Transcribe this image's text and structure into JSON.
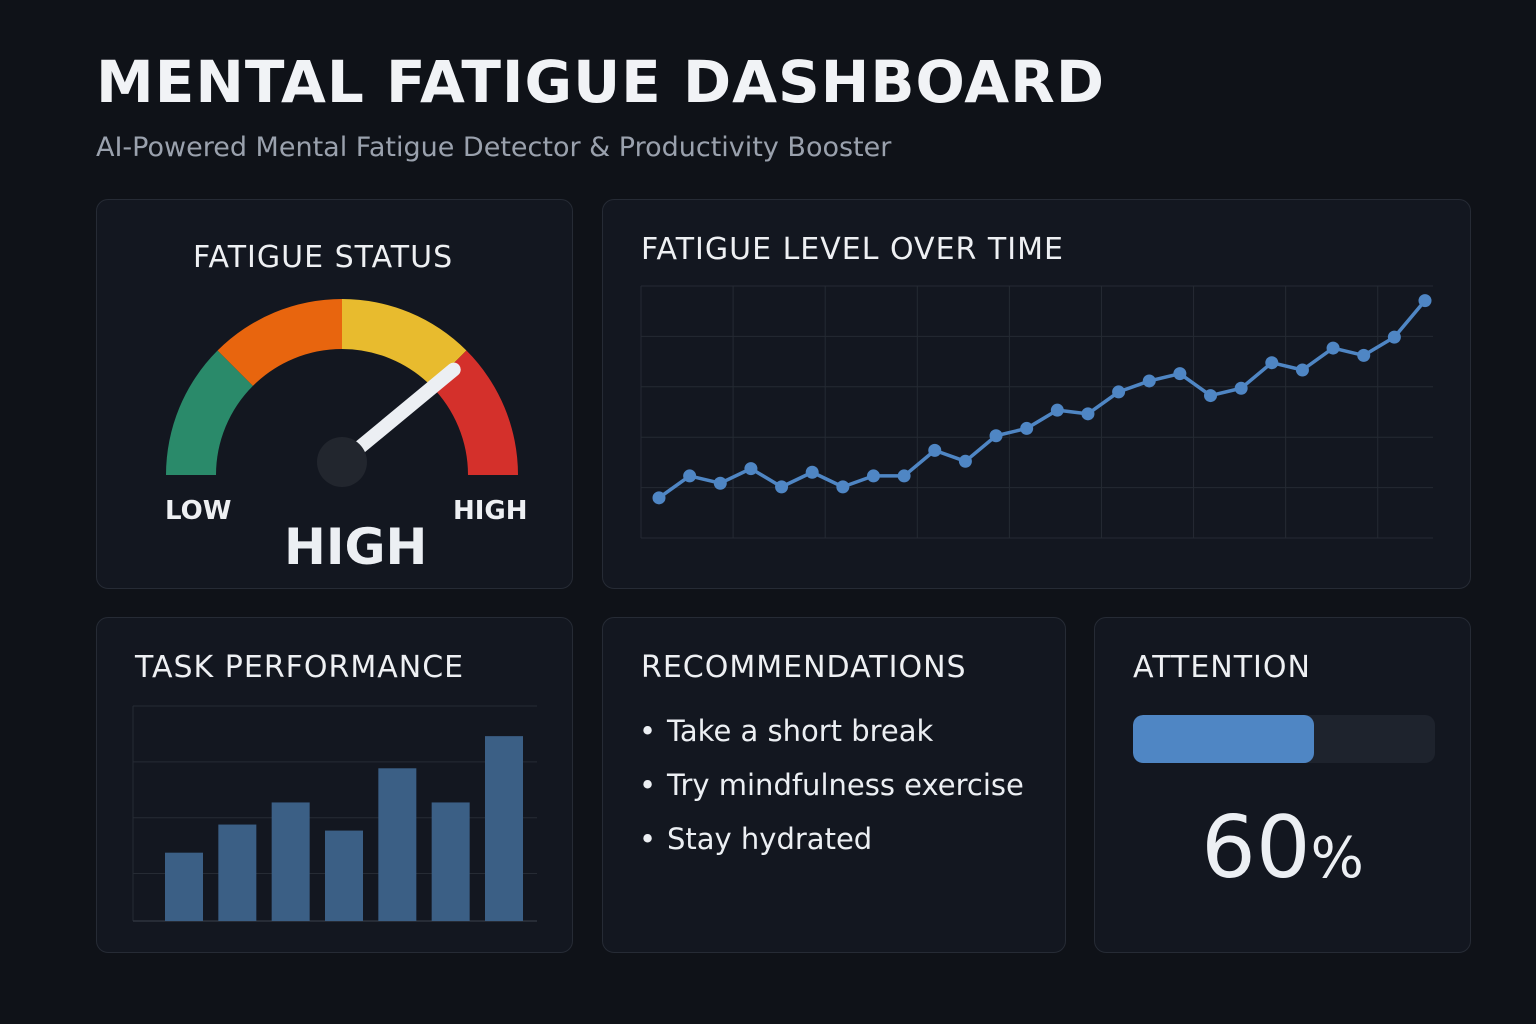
{
  "header": {
    "title": "MENTAL FATIGUE DASHBOARD",
    "subtitle": "AI-Powered Mental Fatigue Detector & Productivity Booster"
  },
  "fatigue_status": {
    "title": "FATIGUE STATUS",
    "low_label": "LOW",
    "high_label": "HIGH",
    "value": "HIGH",
    "needle_level": 0.78,
    "segment_colors": [
      "#2a8a6a",
      "#e8650e",
      "#e8bb2e",
      "#d4302b"
    ]
  },
  "fatigue_over_time": {
    "title": "FATIGUE LEVEL OVER TIME"
  },
  "task_performance": {
    "title": "TASK PERFORMANCE"
  },
  "recommendations": {
    "title": "RECOMMENDATIONS",
    "items": [
      "Take a short break",
      "Try mindfulness exercise",
      "Stay hydrated"
    ]
  },
  "attention": {
    "title": "ATTENTION",
    "value": "60",
    "unit": "%",
    "level": 0.6
  },
  "colors": {
    "accent": "#4f86c4",
    "bar": "#3b5f85"
  },
  "chart_data": [
    {
      "type": "line",
      "title": "FATIGUE LEVEL OVER TIME",
      "x": [
        1,
        2,
        3,
        4,
        5,
        6,
        7,
        8,
        9,
        10,
        11,
        12,
        13,
        14,
        15,
        16,
        17,
        18,
        19,
        20,
        21,
        22,
        23,
        24,
        25,
        26
      ],
      "series": [
        {
          "values": [
            3.1,
            3.7,
            3.5,
            3.9,
            3.4,
            3.8,
            3.4,
            3.7,
            3.7,
            4.4,
            4.1,
            4.8,
            5.0,
            5.5,
            5.4,
            6.0,
            6.3,
            6.5,
            5.9,
            6.1,
            6.8,
            6.6,
            7.2,
            7.0,
            7.5,
            8.5
          ]
        }
      ],
      "ylim": [
        2,
        8.9
      ],
      "grid": true
    },
    {
      "type": "bar",
      "title": "TASK PERFORMANCE",
      "categories": [
        "1",
        "2",
        "3",
        "4",
        "5",
        "6",
        "7"
      ],
      "values": [
        34,
        48,
        59,
        45,
        76,
        59,
        92
      ],
      "ylim": [
        0,
        107
      ],
      "grid": true
    }
  ]
}
